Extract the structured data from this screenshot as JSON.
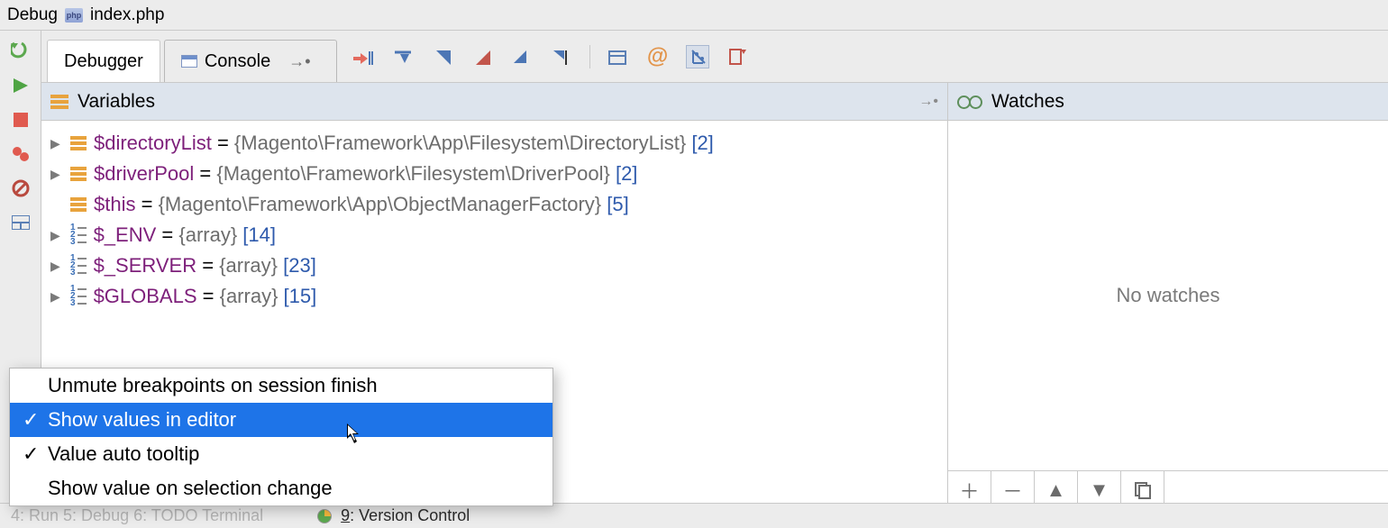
{
  "top": {
    "mode": "Debug",
    "file": "index.php"
  },
  "tabs": {
    "debugger": "Debugger",
    "console": "Console"
  },
  "panes": {
    "variables_title": "Variables",
    "watches_title": "Watches",
    "no_watches": "No watches"
  },
  "vars": [
    {
      "icon": "obj",
      "expand": true,
      "name": "$directoryList",
      "eq": " = ",
      "val": "{Magento\\Framework\\App\\Filesystem\\DirectoryList} ",
      "count": "[2]"
    },
    {
      "icon": "obj",
      "expand": true,
      "name": "$driverPool",
      "eq": " = ",
      "val": "{Magento\\Framework\\Filesystem\\DriverPool} ",
      "count": "[2]"
    },
    {
      "icon": "obj",
      "expand": false,
      "name": "$this",
      "eq": " = ",
      "val": "{Magento\\Framework\\App\\ObjectManagerFactory} ",
      "count": "[5]"
    },
    {
      "icon": "arr",
      "expand": true,
      "name": "$_ENV",
      "eq": " = ",
      "val": "{array} ",
      "count": "[14]"
    },
    {
      "icon": "arr",
      "expand": true,
      "name": "$_SERVER",
      "eq": " = ",
      "val": "{array} ",
      "count": "[23]"
    },
    {
      "icon": "arr",
      "expand": true,
      "name": "$GLOBALS",
      "eq": " = ",
      "val": "{array} ",
      "count": "[15]"
    }
  ],
  "menu": {
    "items": [
      {
        "checked": false,
        "label": "Unmute breakpoints on session finish"
      },
      {
        "checked": true,
        "label": "Show values in editor",
        "selected": true
      },
      {
        "checked": true,
        "label": "Value auto tooltip"
      },
      {
        "checked": false,
        "label": "Show value on selection change"
      }
    ]
  },
  "bottom": {
    "faded_items": "4: Run     5: Debug     6: TODO     Terminal",
    "vc_prefix": "9",
    "vc_label": ": Version Control"
  }
}
